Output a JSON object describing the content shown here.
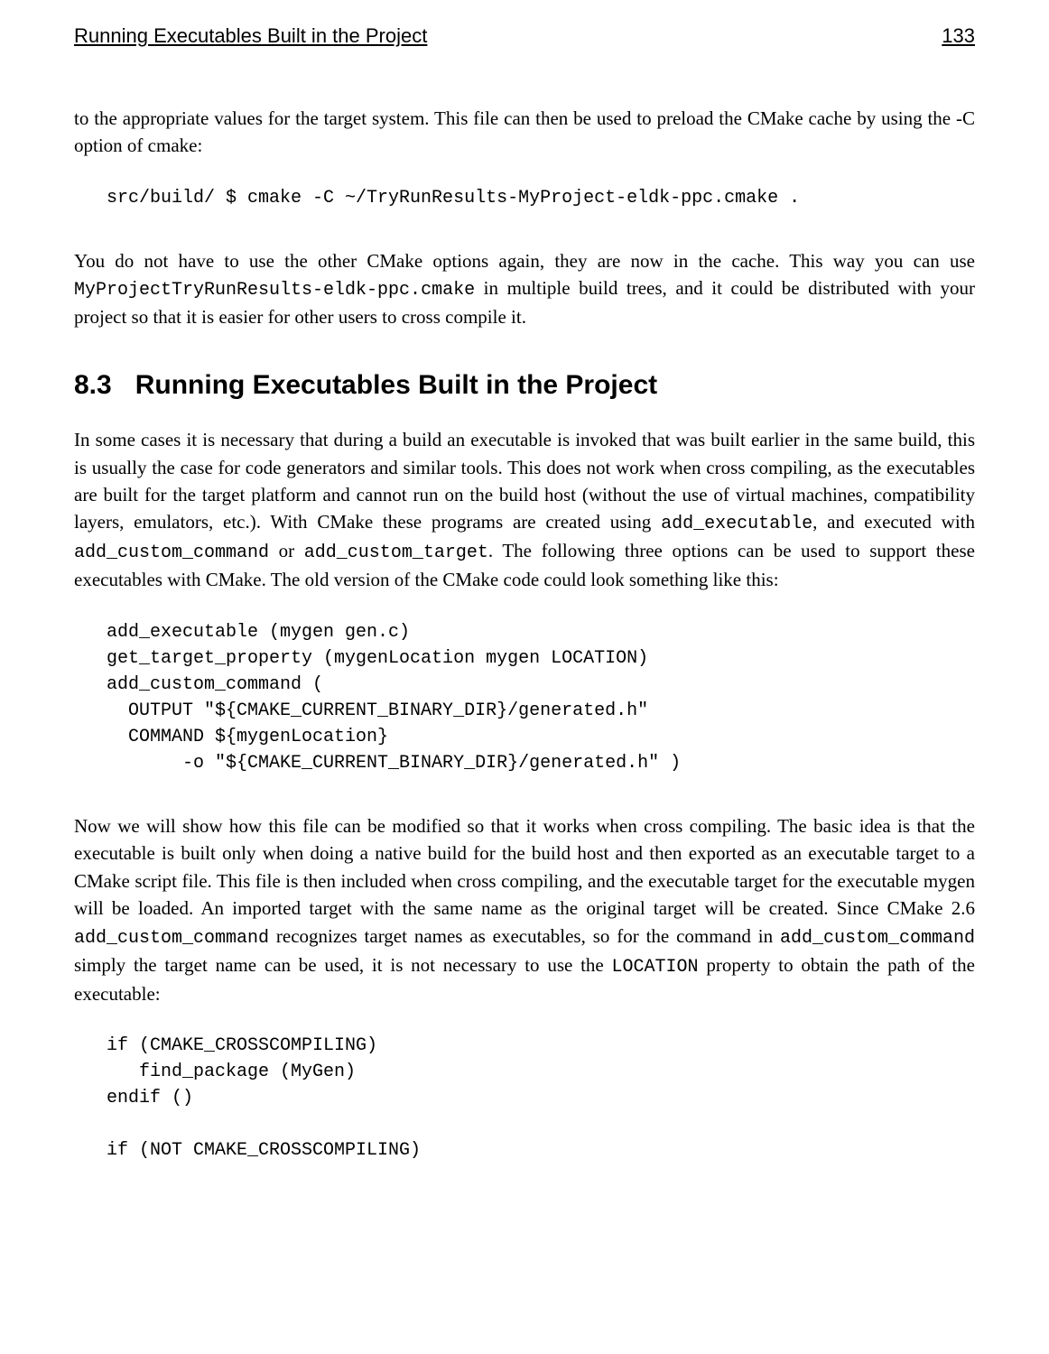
{
  "header": {
    "title": "Running Executables Built in the Project",
    "pageNumber": "133"
  },
  "para1a": "to the appropriate values for the target system. This file can then be used to preload the CMake cache by using the -C option of cmake:",
  "code1": "src/build/ $ cmake -C ~/TryRunResults-MyProject-eldk-ppc.cmake .",
  "para2_a": "You do not have to use the other CMake options again, they are now in the cache. This way you can use ",
  "para2_code": "MyProjectTryRunResults-eldk-ppc.cmake",
  "para2_b": " in multiple build trees, and it could be distributed with your project so that it is easier for other users to cross compile it.",
  "section": {
    "number": "8.3",
    "title": "Running Executables Built in the Project"
  },
  "para3_a": "In some cases it is necessary that during a build an executable is invoked that was built earlier in the same build, this is usually the case for code generators and similar tools. This does not work when cross compiling, as the executables are built for the target platform and cannot run on the build host (without the use of virtual machines, compatibility layers, emulators, etc.). With CMake these programs are created using ",
  "para3_code1": "add_executable",
  "para3_b": ", and executed with ",
  "para3_code2": "add_custom_command",
  "para3_c": " or ",
  "para3_code3": "add_custom_target",
  "para3_d": ". The following three options can be used to support these executables with CMake. The old version of the CMake code could look something like this:",
  "code2": "add_executable (mygen gen.c)\nget_target_property (mygenLocation mygen LOCATION)\nadd_custom_command (\n  OUTPUT \"${CMAKE_CURRENT_BINARY_DIR}/generated.h\"\n  COMMAND ${mygenLocation}\n       -o \"${CMAKE_CURRENT_BINARY_DIR}/generated.h\" )",
  "para4_a": "Now we will show how this file can be modified so that it works when cross compiling. The basic idea is that the executable is built only when doing a native build for the build host and then exported as an executable target to a CMake script file. This file is then included when cross compiling, and the executable target for the executable mygen will be loaded. An imported target with the same name as the original target will be created. Since CMake 2.6 ",
  "para4_code1": "add_custom_command",
  "para4_b": " recognizes target names as executables, so for the command in ",
  "para4_code2": "add_custom_command",
  "para4_c": " simply the target name can be used, it is not necessary to use the ",
  "para4_code3": "LOCATION",
  "para4_d": " property to obtain the path of the executable:",
  "code3": "if (CMAKE_CROSSCOMPILING)\n   find_package (MyGen)\nendif ()\n\nif (NOT CMAKE_CROSSCOMPILING)"
}
